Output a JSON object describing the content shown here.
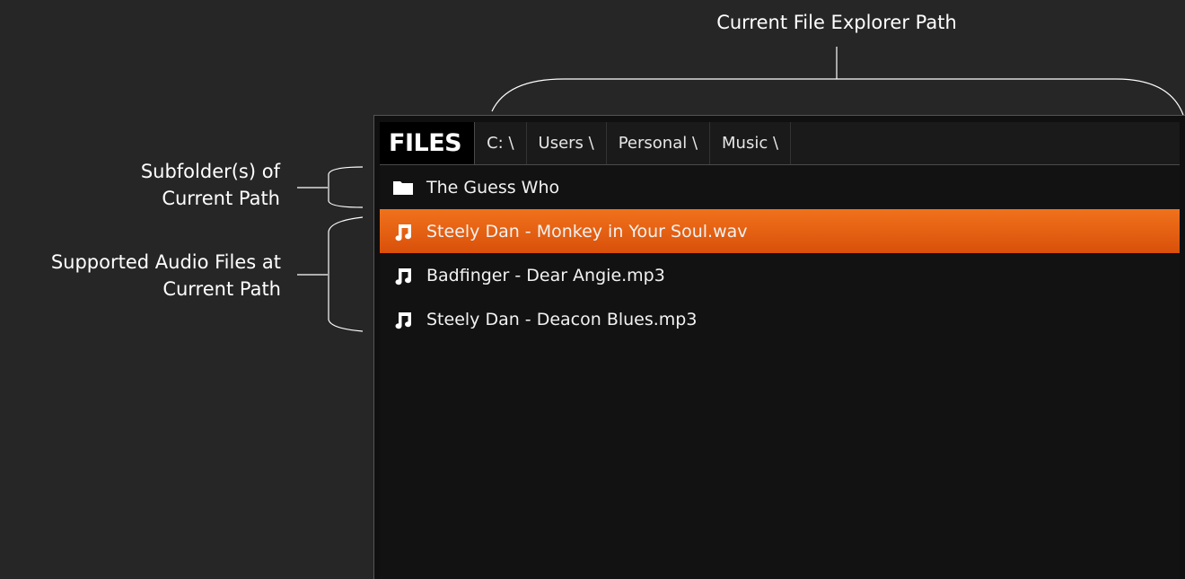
{
  "annotations": {
    "path_label": "Current File Explorer Path",
    "subfolder_label_line1": "Subfolder(s) of",
    "subfolder_label_line2": "Current Path",
    "audio_label_line1": "Supported Audio Files at",
    "audio_label_line2": "Current Path"
  },
  "panel": {
    "title": "FILES",
    "breadcrumbs": [
      "C: \\",
      "Users \\",
      "Personal \\",
      "Music \\"
    ]
  },
  "files": [
    {
      "icon": "folder-icon",
      "name": "The Guess Who",
      "selected": false
    },
    {
      "icon": "music-note-icon",
      "name": "Steely Dan - Monkey in Your Soul.wav",
      "selected": true
    },
    {
      "icon": "music-note-icon",
      "name": "Badfinger - Dear Angie.mp3",
      "selected": false
    },
    {
      "icon": "music-note-icon",
      "name": "Steely Dan - Deacon Blues.mp3",
      "selected": false
    }
  ],
  "colors": {
    "background": "#262626",
    "panel": "#121212",
    "selection": "#e65f10",
    "text": "#ffffff"
  }
}
